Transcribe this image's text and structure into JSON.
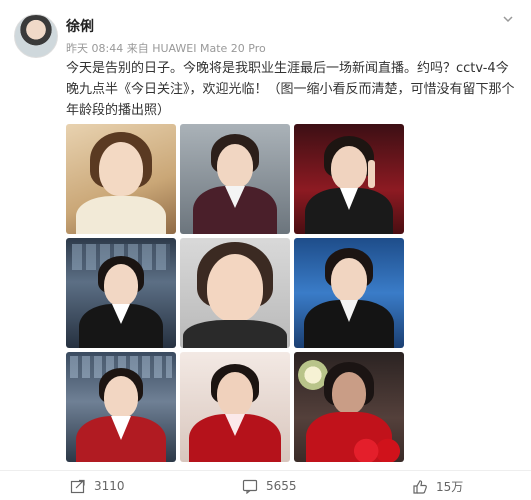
{
  "post": {
    "username": "徐俐",
    "meta": "昨天 08:44 来自 HUAWEI Mate 20 Pro",
    "text": "今天是告别的日子。今晚将是我职业生涯最后一场新闻直播。约吗？cctv-4今晚九点半《今日关注》，欢迎光临！（图一缩小看反而清楚，可惜没有留下那个年龄段的播出照）"
  },
  "photos": [
    {
      "name": "photo-1"
    },
    {
      "name": "photo-2"
    },
    {
      "name": "photo-3"
    },
    {
      "name": "photo-4"
    },
    {
      "name": "photo-5"
    },
    {
      "name": "photo-6"
    },
    {
      "name": "photo-7"
    },
    {
      "name": "photo-8"
    },
    {
      "name": "photo-9"
    }
  ],
  "actions": {
    "repost_count": "3110",
    "comment_count": "5655",
    "like_count": "15万"
  },
  "icons": {
    "menu": "chevron-down-icon",
    "repost": "share-icon",
    "comment": "comment-icon",
    "like": "thumbs-up-icon"
  },
  "colors": {
    "text": "#333333",
    "meta": "#999999",
    "divider": "#eeeeee"
  }
}
